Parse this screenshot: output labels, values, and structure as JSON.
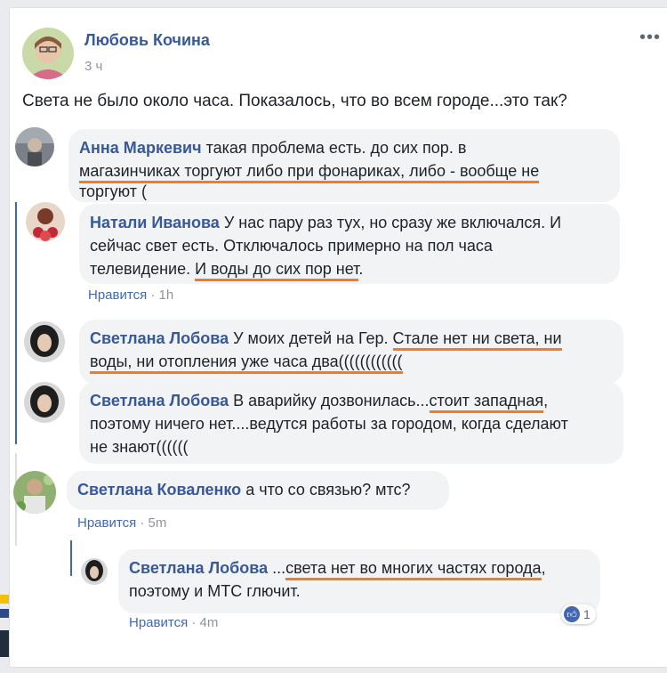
{
  "post": {
    "author": "Любовь Кочина",
    "time": "3 ч",
    "text": "Света не было около часа. Показалось, что во всем городе...это так?"
  },
  "comments": [
    {
      "name": "Анна Маркевич",
      "line1": "такая проблема есть. до сих пор. в",
      "line2": "магазинчиках торгуют либо при фонариках, либо - вообще не",
      "line3": "торгуют ("
    },
    {
      "name": "Натали Иванова",
      "line1": "У нас пару раз тух, но сразу же включался. И",
      "line2": "сейчас свет есть. Отключалось примерно на пол часа",
      "line3a": "телевидение. ",
      "line3b": "И воды до сих пор нет",
      "line3c": ".",
      "like": "Нравится",
      "time": "1h"
    },
    {
      "name": "Светлана Лобова",
      "line1a": "У моих детей на Гер. ",
      "line1b": "Стале нет ни света, ни",
      "line2": "воды, ни отопления уже часа два(((((((((((("
    },
    {
      "name": "Светлана Лобова",
      "line1a": "В аварийку дозвонилась...",
      "line1b": "стоит западная",
      "line1c": ",",
      "line2": "поэтому ничего нет....ведутся работы за городом, когда сделают",
      "line3": "не знают(((((("
    },
    {
      "name": "Светлана Коваленко",
      "text": "а что со связью? мтс?",
      "like": "Нравится",
      "time": "5m"
    },
    {
      "name": "Светлана Лобова",
      "line1a": "...",
      "line1b": "света нет во многих частях города",
      "line1c": ",",
      "line2": "поэтому и МТС глючит.",
      "like": "Нравится",
      "time": "4m",
      "reaction_count": "1"
    }
  ],
  "ui": {
    "dot_sep": "·",
    "more_icon": "more-options-icon",
    "like_icon": "thumbs-up-icon"
  },
  "colors": {
    "name": "#385898",
    "highlight": "#f57b20",
    "thread": "#4267b2",
    "bubble": "#f2f3f5"
  }
}
